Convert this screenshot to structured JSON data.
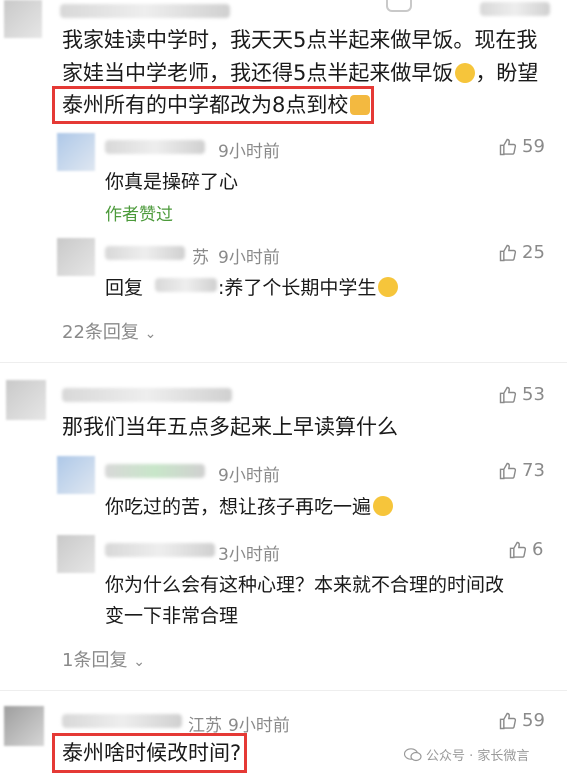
{
  "comment1": {
    "text_line1": "我家娃读中学时，我天天5点半起来做早饭。现在我",
    "text_line2": "家娃当中学老师，我还得5点半起来做早饭",
    "text_line2_end": "，盼望",
    "text_line3": "泰州所有的中学都改为8点到校",
    "emoji1": "😪",
    "emoji2": "🙏",
    "replies": [
      {
        "time": "9小时前",
        "likes": "59",
        "text": "你真是操碎了心",
        "badge": "作者赞过"
      },
      {
        "location": "苏",
        "time": "9小时前",
        "likes": "25",
        "prefix": "回复",
        "text": ":养了个长期中学生",
        "emoji": "😂"
      }
    ],
    "more": "22条回复"
  },
  "comment2": {
    "likes": "53",
    "text": "那我们当年五点多起来上早读算什么",
    "replies": [
      {
        "time": "9小时前",
        "likes": "73",
        "text": "你吃过的苦，想让孩子再吃一遍",
        "emoji": "🤔"
      },
      {
        "time": "3小时前",
        "likes": "6",
        "text_line1": "你为什么会有这种心理？本来就不合理的时间改",
        "text_line2": "变一下非常合理"
      }
    ],
    "more": "1条回复"
  },
  "comment3": {
    "location": "江苏",
    "time": "9小时前",
    "likes": "59",
    "text": "泰州啥时候改时间?"
  },
  "watermark": "公众号 · 家长微言",
  "colors": {
    "highlight_border": "#e53935",
    "muted": "#8a8a8a",
    "author_liked": "#4c9a3b"
  },
  "icons": [
    "thumbs-up-icon",
    "chevron-down-icon",
    "wechat-icon"
  ]
}
